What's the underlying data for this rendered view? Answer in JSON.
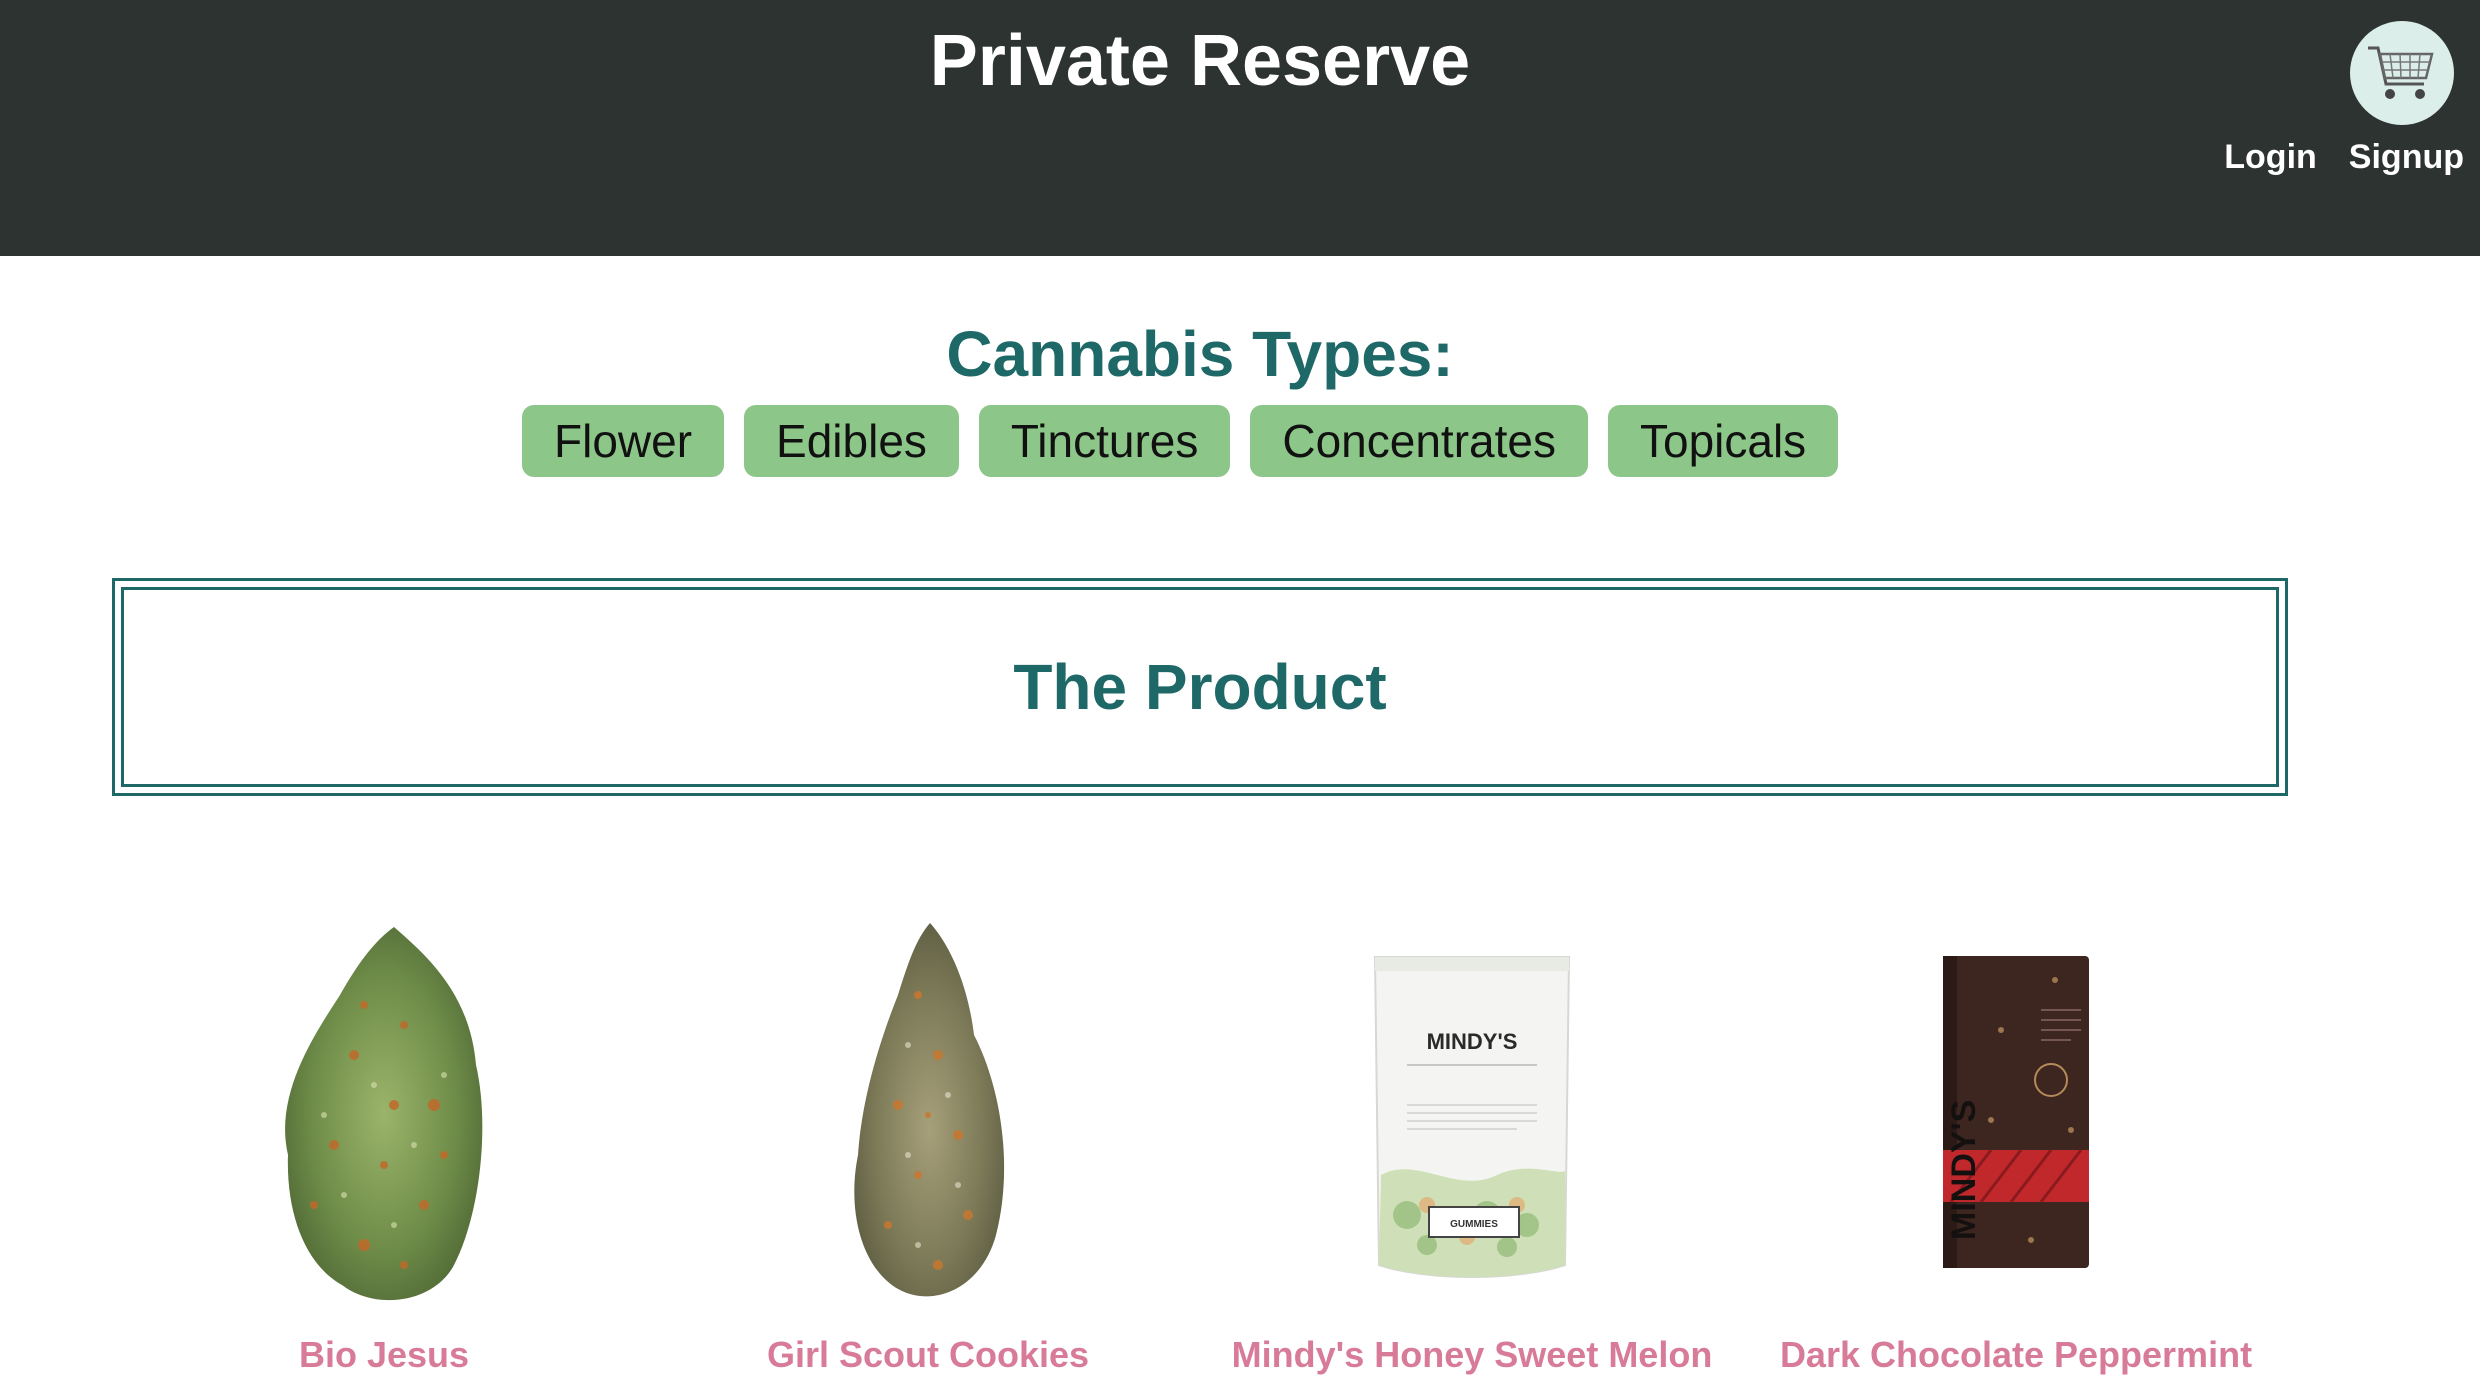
{
  "header": {
    "title": "Private Reserve",
    "cart_icon": "shopping-cart-icon",
    "login_label": "Login",
    "signup_label": "Signup"
  },
  "types": {
    "title": "Cannabis Types:",
    "items": [
      "Flower",
      "Edibles",
      "Tinctures",
      "Concentrates",
      "Topicals"
    ]
  },
  "product_section": {
    "title": "The Product"
  },
  "products": [
    {
      "name": "Bio Jesus",
      "image_icon": "cannabis-bud-image"
    },
    {
      "name": "Girl Scout Cookies",
      "image_icon": "cannabis-bud-image"
    },
    {
      "name": "Mindy's Honey Sweet Melon",
      "image_icon": "gummies-pouch-image",
      "package_brand": "MINDY'S",
      "package_label": "GUMMIES"
    },
    {
      "name": "Dark Chocolate Peppermint",
      "image_icon": "chocolate-bar-image",
      "package_brand": "MINDY'S"
    }
  ],
  "colors": {
    "header_bg": "#2d3331",
    "accent_teal": "#1e6868",
    "type_button_bg": "#8dc689",
    "product_name": "#d77b99",
    "cart_bg": "#dbeee9"
  }
}
